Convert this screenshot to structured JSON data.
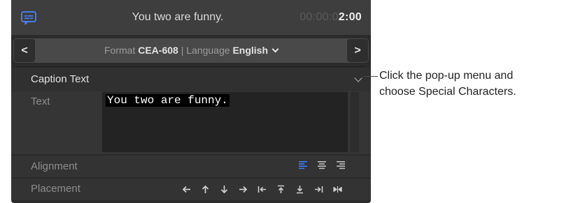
{
  "header": {
    "icon": "closed-captions-icon",
    "title": "You two are funny.",
    "timecode_dim": "00:00:0",
    "timecode_bright": "2:00"
  },
  "format_bar": {
    "prev_label": "<",
    "next_label": ">",
    "format_prefix": "Format",
    "format_value": "CEA-608",
    "separator": "|",
    "language_prefix": "Language",
    "language_value": "English"
  },
  "section": {
    "title": "Caption Text"
  },
  "text_row": {
    "label": "Text",
    "value": "You two are funny."
  },
  "alignment_row": {
    "label": "Alignment",
    "options": [
      "align-left-icon",
      "align-center-icon",
      "align-right-icon"
    ],
    "selected": "align-left-icon"
  },
  "placement_row": {
    "label": "Placement",
    "options": [
      "arrow-left-icon",
      "arrow-up-icon",
      "arrow-down-icon",
      "arrow-right-icon",
      "move-to-left-edge-icon",
      "move-to-top-icon",
      "move-to-bottom-icon",
      "move-to-right-edge-icon",
      "center-horizontal-icon"
    ]
  },
  "callout": {
    "line1": "Click the pop-up menu and",
    "line2": "choose Special Characters."
  },
  "colors": {
    "accent": "#3f7cff",
    "panel_bg": "#2b2b2b",
    "header_bg": "#3e3e3e"
  }
}
